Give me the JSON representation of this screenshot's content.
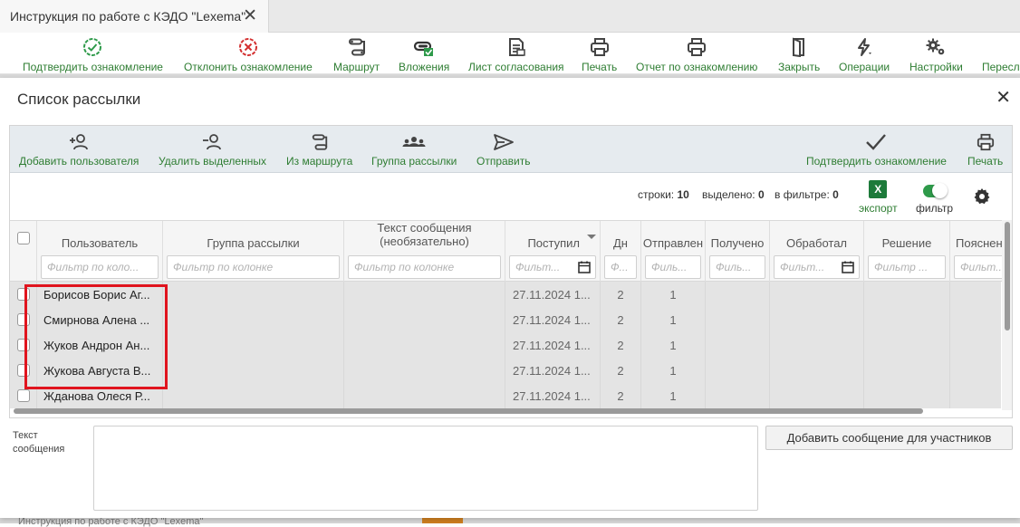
{
  "tab": {
    "title": "Инструкция по работе с КЭДО \"Lexema\"",
    "close": "✕"
  },
  "main_toolbar": {
    "items": [
      {
        "label": "Подтвердить ознакомление",
        "icon": "check-circle-icon"
      },
      {
        "label": "Отклонить ознакомление",
        "icon": "x-circle-icon"
      },
      {
        "label": "Маршрут",
        "icon": "route-icon"
      },
      {
        "label": "Вложения",
        "icon": "paperclip-icon"
      },
      {
        "label": "Лист согласования",
        "icon": "approval-sheet-icon"
      },
      {
        "label": "Печать",
        "icon": "printer-icon"
      },
      {
        "label": "Отчет по ознакомлению",
        "icon": "printer-icon"
      },
      {
        "label": "Закрыть",
        "icon": "close-door-icon"
      },
      {
        "label": "Операции",
        "icon": "lightning-icon"
      },
      {
        "label": "Настройки",
        "icon": "gears-icon"
      },
      {
        "label": "Пересл",
        "icon": "forward-icon"
      }
    ]
  },
  "modal": {
    "title": "Список рассылки",
    "close": "✕",
    "toolbar": {
      "add_user": "Добавить пользователя",
      "remove_selected": "Удалить выделенных",
      "from_route": "Из маршрута",
      "mailing_group": "Группа рассылки",
      "send": "Отправить",
      "confirm": "Подтвердить ознакомление",
      "print": "Печать"
    },
    "counters": {
      "rows_label": "строки:",
      "rows_value": "10",
      "selected_label": "выделено:",
      "selected_value": "0",
      "filter_label": "в фильтре:",
      "filter_value": "0"
    },
    "export_label": "экспорт",
    "excel_letter": "X",
    "filter_toggle_label": "фильтр",
    "columns": [
      {
        "title": "Пользователь",
        "placeholder": "Фильтр по коло..."
      },
      {
        "title": "Группа рассылки",
        "placeholder": "Фильтр по колонке"
      },
      {
        "title": "Текст сообщения\n(необязательно)",
        "placeholder": "Фильтр по колонке"
      },
      {
        "title": "Поступил",
        "placeholder": "Фильт..."
      },
      {
        "title": "Дн",
        "placeholder": "Ф..."
      },
      {
        "title": "Отправлен",
        "placeholder": "Филь..."
      },
      {
        "title": "Получено",
        "placeholder": "Филь..."
      },
      {
        "title": "Обработал",
        "placeholder": "Фильт..."
      },
      {
        "title": "Решение",
        "placeholder": "Фильтр ..."
      },
      {
        "title": "Пояснен",
        "placeholder": "Фильт..."
      }
    ],
    "rows": [
      {
        "user": "Борисов Борис Аг...",
        "received": "27.11.2024 1...",
        "days": "2",
        "sent": "1"
      },
      {
        "user": "Смирнова Алена ...",
        "received": "27.11.2024 1...",
        "days": "2",
        "sent": "1"
      },
      {
        "user": "Жуков Андрон Ан...",
        "received": "27.11.2024 1...",
        "days": "2",
        "sent": "1"
      },
      {
        "user": "Жукова Августа В...",
        "received": "27.11.2024 1...",
        "days": "2",
        "sent": "1"
      },
      {
        "user": "Жданова Олеся Р...",
        "received": "27.11.2024 1...",
        "days": "2",
        "sent": "1"
      }
    ],
    "message_label": "Текст сообщения",
    "add_message_button": "Добавить сообщение для участников"
  },
  "background_text": "Инструкция по работе с КЭДО \"Lexema\"",
  "colors": {
    "accent_green": "#2e7d32",
    "highlight_red": "#e0141e",
    "excel_green": "#1d7a3a"
  }
}
